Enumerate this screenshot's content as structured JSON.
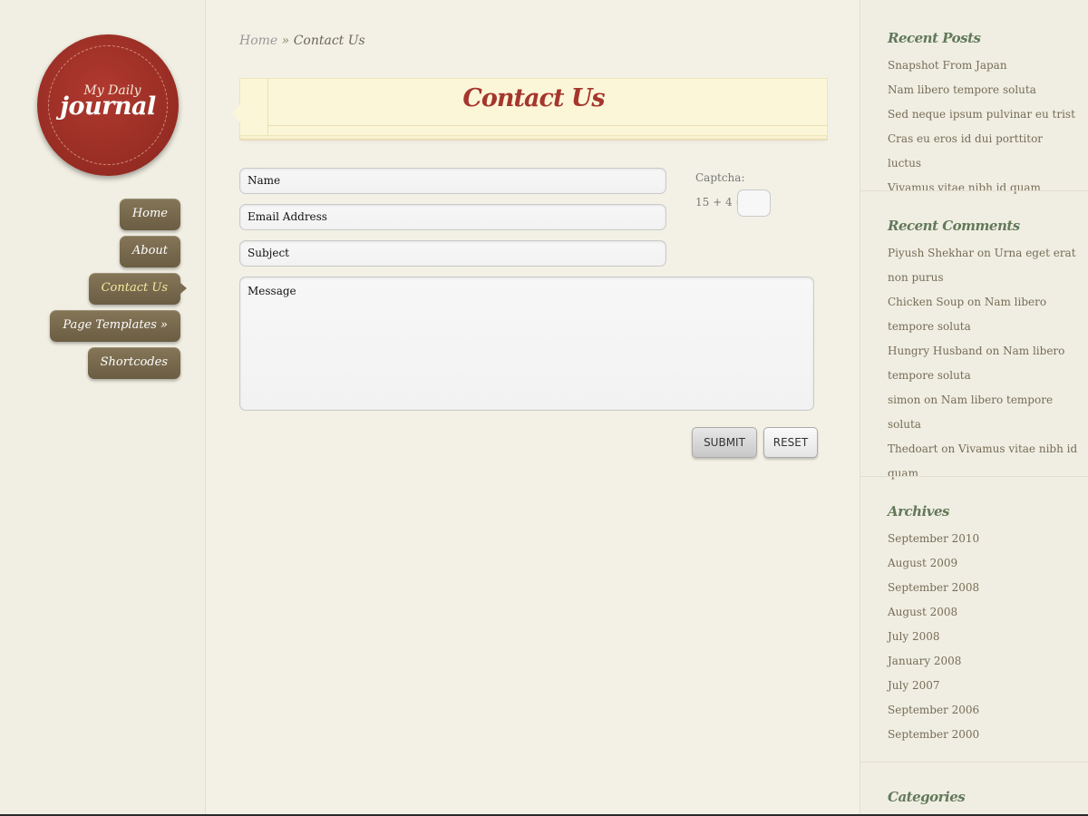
{
  "logo": {
    "line1": "My Daily",
    "line2": "journal"
  },
  "nav": [
    {
      "label": "Home",
      "active": false
    },
    {
      "label": "About",
      "active": false
    },
    {
      "label": "Contact Us",
      "active": true
    },
    {
      "label": "Page Templates »",
      "active": false
    },
    {
      "label": "Shortcodes",
      "active": false
    }
  ],
  "breadcrumb": {
    "home": "Home",
    "separator": "»",
    "current": "Contact Us"
  },
  "page": {
    "title": "Contact Us"
  },
  "form": {
    "name_placeholder": "Name",
    "email_placeholder": "Email Address",
    "subject_placeholder": "Subject",
    "message_placeholder": "Message",
    "captcha_label": "Captcha:",
    "captcha_equation": "15 + 4 =",
    "submit_label": "SUBMIT",
    "reset_label": "RESET"
  },
  "sidebar": {
    "recent_posts": {
      "title": "Recent Posts",
      "items": [
        "Snapshot From Japan",
        "Nam libero tempore soluta",
        "Sed neque ipsum pulvinar eu trist",
        "Cras eu eros id dui porttitor luctus",
        "Vivamus vitae nibh id quam"
      ]
    },
    "recent_comments": {
      "title": "Recent Comments",
      "items": [
        "Piyush Shekhar on Urna eget erat non purus",
        "Chicken Soup on Nam libero tempore soluta",
        "Hungry Husband on Nam libero tempore soluta",
        "simon on Nam libero tempore soluta",
        "Thedoart on Vivamus vitae nibh id quam"
      ]
    },
    "archives": {
      "title": "Archives",
      "items": [
        "September 2010",
        "August 2009",
        "September 2008",
        "August 2008",
        "July 2008",
        "January 2008",
        "July 2007",
        "September 2006",
        "September 2000"
      ]
    },
    "categories": {
      "title": "Categories"
    }
  },
  "colors": {
    "accent_red": "#a5362d",
    "nav_brown": "#7a6b4f",
    "widget_green": "#63795a"
  }
}
